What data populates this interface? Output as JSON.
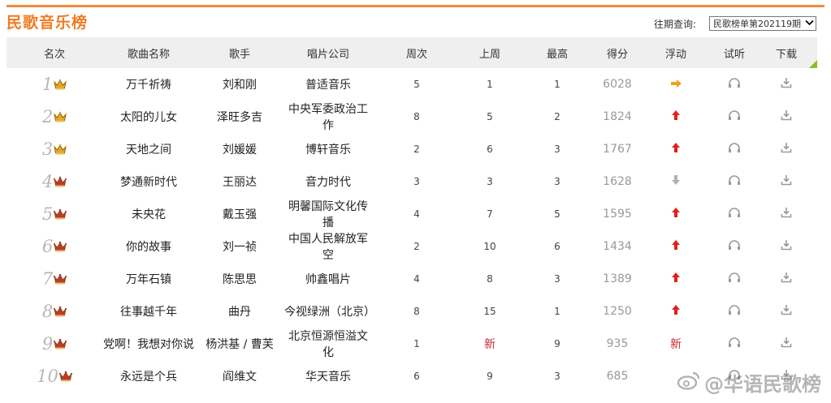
{
  "header": {
    "title": "民歌音乐榜",
    "query_label": "往期查询:",
    "period_select": "民歌榜单第202119期"
  },
  "table": {
    "columns": [
      "名次",
      "歌曲名称",
      "歌手",
      "唱片公司",
      "周次",
      "上周",
      "最高",
      "得分",
      "浮动",
      "试听",
      "下载"
    ],
    "rows": [
      {
        "rank": "1",
        "crown": "gold",
        "song": "万千祈祷",
        "singer": "刘和刚",
        "label": "普适音乐",
        "weeks": "5",
        "last": "1",
        "best": "1",
        "score": "6028",
        "trend": "flat"
      },
      {
        "rank": "2",
        "crown": "gold",
        "song": "太阳的儿女",
        "singer": "泽旺多吉",
        "label": "中央军委政治工作",
        "weeks": "8",
        "last": "5",
        "best": "2",
        "score": "1824",
        "trend": "up"
      },
      {
        "rank": "3",
        "crown": "gold",
        "song": "天地之间",
        "singer": "刘媛媛",
        "label": "博轩音乐",
        "weeks": "2",
        "last": "6",
        "best": "3",
        "score": "1767",
        "trend": "up"
      },
      {
        "rank": "4",
        "crown": "red",
        "song": "梦通新时代",
        "singer": "王丽达",
        "label": "音力时代",
        "weeks": "3",
        "last": "3",
        "best": "3",
        "score": "1628",
        "trend": "down"
      },
      {
        "rank": "5",
        "crown": "red",
        "song": "未央花",
        "singer": "戴玉强",
        "label": "明馨国际文化传播",
        "weeks": "4",
        "last": "7",
        "best": "5",
        "score": "1595",
        "trend": "up"
      },
      {
        "rank": "6",
        "crown": "red",
        "song": "你的故事",
        "singer": "刘一祯",
        "label": "中国人民解放军空",
        "weeks": "2",
        "last": "10",
        "best": "6",
        "score": "1434",
        "trend": "up"
      },
      {
        "rank": "7",
        "crown": "red",
        "song": "万年石镇",
        "singer": "陈思思",
        "label": "帅鑫唱片",
        "weeks": "4",
        "last": "8",
        "best": "3",
        "score": "1389",
        "trend": "up"
      },
      {
        "rank": "8",
        "crown": "red",
        "song": "往事越千年",
        "singer": "曲丹",
        "label": "今视绿洲（北京）",
        "weeks": "8",
        "last": "15",
        "best": "1",
        "score": "1250",
        "trend": "up"
      },
      {
        "rank": "9",
        "crown": "red",
        "song": "党啊！我想对你说",
        "singer": "杨洪基 / 曹芙",
        "label": "北京恒源恒溢文化",
        "weeks": "1",
        "last": "新",
        "best": "9",
        "score": "935",
        "trend": "new",
        "trend_text": "新"
      },
      {
        "rank": "10",
        "crown": "red",
        "song": "永远是个兵",
        "singer": "阎维文",
        "label": "华天音乐",
        "weeks": "6",
        "last": "9",
        "best": "3",
        "score": "685",
        "trend": "none"
      }
    ]
  },
  "watermark": "@华语民歌榜",
  "colors": {
    "accent": "#f07c24",
    "header_bg": "#efefef",
    "up": "#e0201c",
    "flat": "#f0a020",
    "down": "#b0b0b0",
    "new": "#c8292f",
    "crown_gold": "#e8a818",
    "crown_red": "#c0392b"
  },
  "icons": {
    "listen": "headphone-icon",
    "download": "download-icon",
    "crown": "crown-icon"
  }
}
